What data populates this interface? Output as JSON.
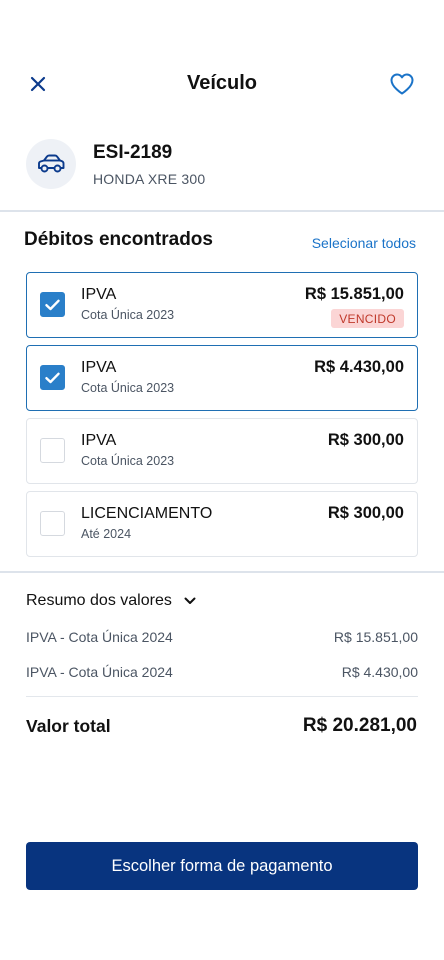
{
  "header": {
    "title": "Veículo"
  },
  "vehicle": {
    "plate": "ESI-2189",
    "model": "HONDA XRE 300"
  },
  "debts": {
    "title": "Débitos encontrados",
    "select_all": "Selecionar todos",
    "items": [
      {
        "name": "IPVA",
        "sub": "Cota Única 2023",
        "amount": "R$ 15.851,00",
        "badge": "VENCIDO",
        "checked": true
      },
      {
        "name": "IPVA",
        "sub": "Cota Única 2023",
        "amount": "R$ 4.430,00",
        "checked": true
      },
      {
        "name": "IPVA",
        "sub": "Cota Única 2023",
        "amount": "R$ 300,00",
        "checked": false
      },
      {
        "name": "LICENCIAMENTO",
        "sub": "Até 2024",
        "amount": "R$ 300,00",
        "checked": false
      }
    ]
  },
  "summary": {
    "title": "Resumo dos valores",
    "rows": [
      {
        "label": "IPVA - Cota Única 2024",
        "amount": "R$ 15.851,00"
      },
      {
        "label": "IPVA - Cota Única 2024",
        "amount": "R$ 4.430,00"
      }
    ],
    "total_label": "Valor total",
    "total_value": "R$ 20.281,00"
  },
  "footer": {
    "pay_label": "Escolher forma de pagamento"
  },
  "colors": {
    "accent": "#1a73c8",
    "primary_button": "#08347f",
    "checkbox_checked": "#2a7fc9",
    "badge_bg": "#fbd5d5",
    "badge_text": "#c0392b"
  },
  "icons": {
    "close": "close-icon",
    "favorite": "heart-icon",
    "vehicle": "car-icon",
    "check": "check-icon",
    "expand": "chevron-down-icon"
  }
}
